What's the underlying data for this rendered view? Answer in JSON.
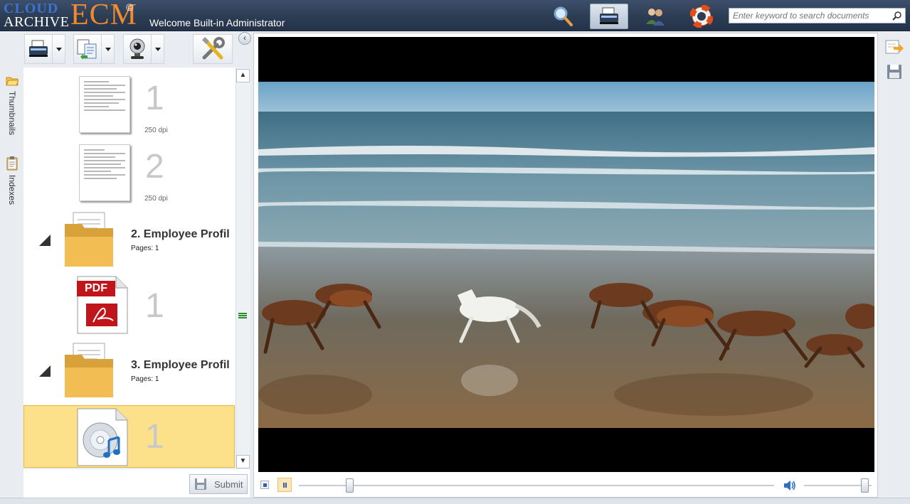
{
  "header": {
    "logo_cloud": "CLOUD",
    "logo_archive": "ARCHIVE",
    "logo_ecm": "ECM",
    "logo_mark": "©",
    "welcome": "Welcome Built-in Administrator",
    "search_placeholder": "Enter keyword to search documents",
    "buttons": [
      {
        "name": "search-icon",
        "active": false
      },
      {
        "name": "scanner-icon",
        "active": true
      },
      {
        "name": "users-icon",
        "active": false
      },
      {
        "name": "lifebuoy-icon",
        "active": false
      }
    ]
  },
  "side_tabs": {
    "thumbnails": "Thumbnails",
    "indexes": "Indexes"
  },
  "toolbar": {
    "buttons": [
      "scanner-icon",
      "import-icon",
      "webcam-icon",
      "tools-icon"
    ]
  },
  "tree": {
    "pages": [
      {
        "number": "1",
        "dpi": "250 dpi"
      },
      {
        "number": "2",
        "dpi": "250 dpi"
      }
    ],
    "documents": [
      {
        "title": "2. Employee Profil",
        "pages": "Pages: 1",
        "page_number": "1",
        "file_icon": "pdf-icon",
        "pdf_label": "PDF"
      },
      {
        "title": "3. Employee Profil",
        "pages": "Pages: 1",
        "page_number": "1",
        "file_icon": "audio-file-icon"
      }
    ]
  },
  "submit": {
    "label": "Submit"
  },
  "player": {
    "seek_fraction": 0.1,
    "volume_fraction": 0.95
  },
  "colors": {
    "header_bg": "#2c3c53",
    "ecm_orange": "#ee8a2f",
    "cloud_blue": "#3b73d1",
    "selection": "#fde08a"
  }
}
